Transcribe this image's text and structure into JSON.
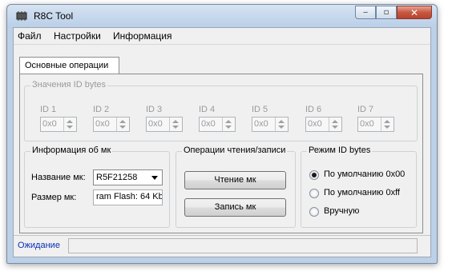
{
  "window": {
    "title": "R8C Tool",
    "controls": {
      "minimize": "‒",
      "maximize": "▫",
      "close": "✕"
    }
  },
  "menu": [
    "Файл",
    "Настройки",
    "Информация"
  ],
  "tabs": {
    "active": "Основные операции"
  },
  "id_bytes": {
    "title": "Значения ID bytes",
    "fields": [
      {
        "label": "ID 1",
        "value": "0x0"
      },
      {
        "label": "ID 2",
        "value": "0x0"
      },
      {
        "label": "ID 3",
        "value": "0x0"
      },
      {
        "label": "ID 4",
        "value": "0x0"
      },
      {
        "label": "ID 5",
        "value": "0x0"
      },
      {
        "label": "ID 6",
        "value": "0x0"
      },
      {
        "label": "ID 7",
        "value": "0x0"
      }
    ]
  },
  "mcu_info": {
    "title": "Информация об мк",
    "name_label": "Название мк:",
    "name_value": "R5F21258",
    "size_label": "Размер мк:",
    "size_value": "ram Flash: 64 Kb"
  },
  "operations": {
    "title": "Операции чтения/записи",
    "read_button": "Чтение мк",
    "write_button": "Запись мк"
  },
  "id_mode": {
    "title": "Режим ID bytes",
    "options": [
      {
        "label": "По умолчанию 0x00",
        "checked": true
      },
      {
        "label": "По умолчанию 0xff",
        "checked": false
      },
      {
        "label": "Вручную",
        "checked": false
      }
    ]
  },
  "status": {
    "text": "Ожидание"
  }
}
